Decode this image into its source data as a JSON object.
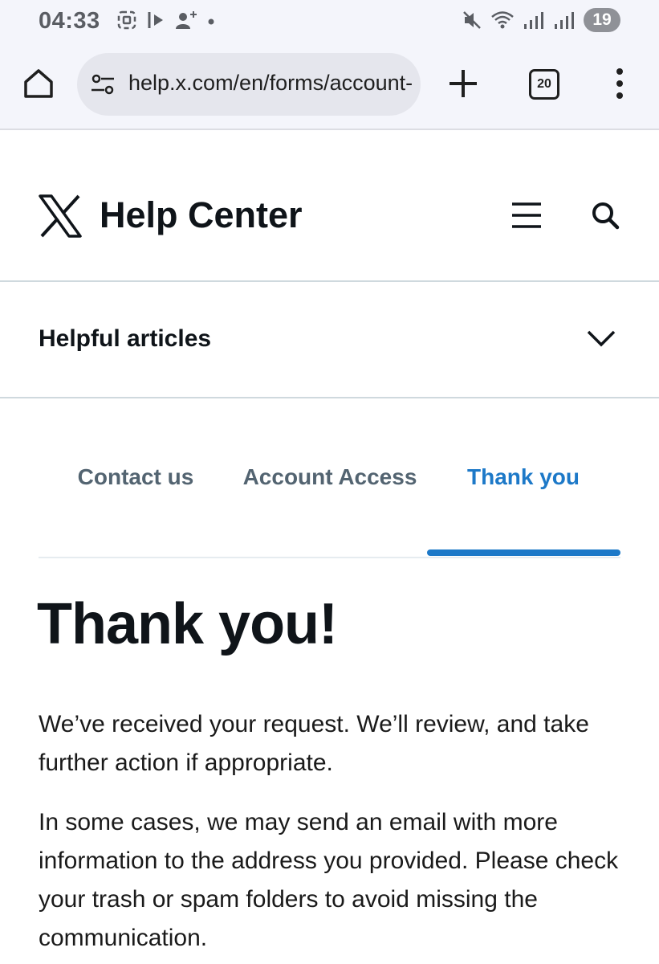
{
  "status_bar": {
    "time": "04:33",
    "battery": "19"
  },
  "browser": {
    "url": "help.x.com/en/forms/account-",
    "tab_count": "20",
    "icons": [
      "home-icon",
      "site-settings-icon",
      "new-tab-icon",
      "tab-switcher-icon",
      "more-menu-icon"
    ]
  },
  "header": {
    "title": "Help Center",
    "icons": [
      "x-logo",
      "menu-icon",
      "search-icon"
    ]
  },
  "helpful_articles": {
    "label": "Helpful articles"
  },
  "steps": {
    "items": [
      {
        "label": "Contact us"
      },
      {
        "label": "Account Access"
      },
      {
        "label": "Thank you"
      }
    ],
    "active_index": 2,
    "active_color": "#1d79c8"
  },
  "content": {
    "title": "Thank you!",
    "paragraph_1": "We’ve received your request. We’ll review, and take further action if appropriate.",
    "paragraph_2": "In some cases, we may send an email with more information to the address you provided. Please check your trash or spam folders to avoid missing the communication."
  }
}
